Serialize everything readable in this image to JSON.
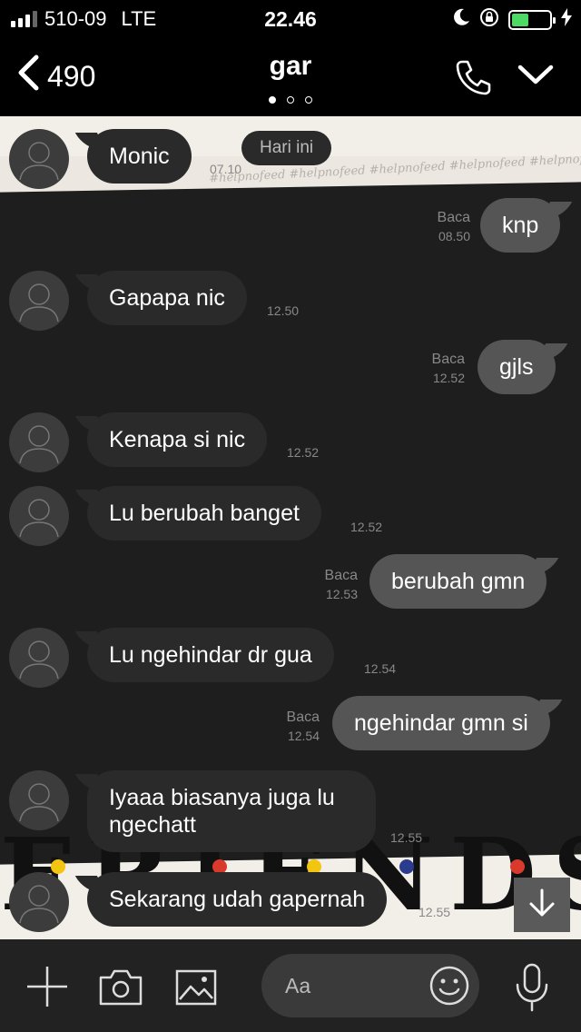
{
  "status_bar": {
    "carrier": "510-09",
    "network": "LTE",
    "time": "22.46",
    "battery_level": 0.45,
    "battery_color": "#4cd964"
  },
  "header": {
    "back_count": "490",
    "title": "gar",
    "page_dots": 3,
    "active_dot": 0,
    "icons": [
      "chevron-left-icon",
      "phone-icon",
      "chevron-down-icon"
    ]
  },
  "chat": {
    "date_label": "Hari ini",
    "read_label": "Baca",
    "messages": [
      {
        "dir": "in",
        "text": "Monic",
        "time": "07.10"
      },
      {
        "dir": "out",
        "text": "knp",
        "time": "08.50",
        "read": true
      },
      {
        "dir": "in",
        "text": "Gapapa nic",
        "time": "12.50"
      },
      {
        "dir": "out",
        "text": "gjls",
        "time": "12.52",
        "read": true
      },
      {
        "dir": "in",
        "text": "Kenapa si nic",
        "time": "12.52"
      },
      {
        "dir": "in",
        "text": "Lu berubah banget",
        "time": "12.52"
      },
      {
        "dir": "out",
        "text": "berubah gmn",
        "time": "12.53",
        "read": true
      },
      {
        "dir": "in",
        "text": "Lu ngehindar dr gua",
        "time": "12.54"
      },
      {
        "dir": "out",
        "text": "ngehindar gmn si",
        "time": "12.54",
        "read": true
      },
      {
        "dir": "in",
        "text": "Iyaaa biasanya juga lu ngechatt",
        "time": "12.55"
      },
      {
        "dir": "in",
        "text": "Sekarang udah gapernah",
        "time": "12.55"
      }
    ],
    "background_colors": {
      "dark": "#1e1e1e",
      "light": "#f2efe9",
      "incoming": "#2a2a2a",
      "outgoing": "#555555"
    }
  },
  "input_bar": {
    "placeholder": "Aa",
    "icons": [
      "plus-icon",
      "camera-icon",
      "image-icon",
      "emoji-icon",
      "microphone-icon"
    ]
  }
}
